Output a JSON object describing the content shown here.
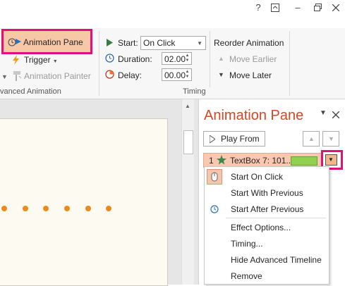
{
  "titlebar": {
    "help": "?",
    "restore": "▣",
    "minimize": "–",
    "maximize": "☐"
  },
  "ribbon": {
    "animation_pane": "Animation Pane",
    "trigger": "Trigger",
    "animation_painter": "Animation Painter",
    "group_advanced": "vanced Animation",
    "start_label": "Start:",
    "start_value": "On Click",
    "duration_label": "Duration:",
    "duration_value": "02.00",
    "delay_label": "Delay:",
    "delay_value": "00.00",
    "group_timing": "Timing",
    "reorder_title": "Reorder Animation",
    "move_earlier": "Move Earlier",
    "move_later": "Move Later"
  },
  "pane": {
    "title": "Animation Pane",
    "play_from": "Play From",
    "item_number": "1",
    "item_label": "TextBox 7: 101..."
  },
  "menu": {
    "items": [
      "Start On Click",
      "Start With Previous",
      "Start After Previous",
      "Effect Options...",
      "Timing...",
      "Hide Advanced Timeline",
      "Remove"
    ]
  },
  "colors": {
    "accent": "#d24726",
    "highlight": "#e2107b",
    "dot": "#ec8a1c",
    "selected_row": "#f8c8b0",
    "bar": "#92d050"
  }
}
